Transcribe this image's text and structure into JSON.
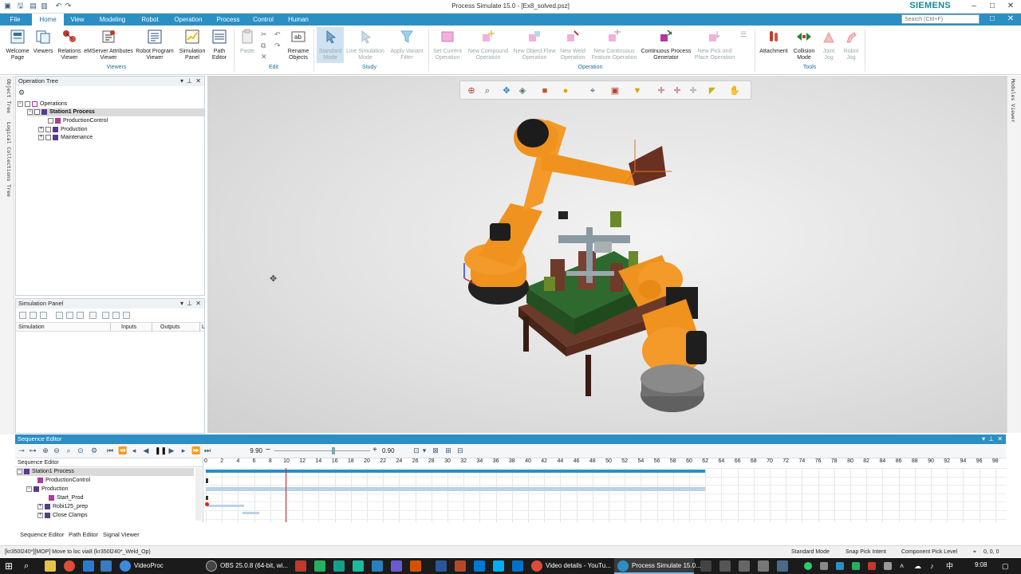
{
  "window": {
    "title": "Process Simulate 15.0 - [Ex8_solved.psz]",
    "brand": "SIEMENS",
    "search_placeholder": "Search (Ctrl+F)",
    "controls": [
      "–",
      "□",
      "✕"
    ],
    "sub_controls": [
      "–",
      "□",
      "✕"
    ]
  },
  "ribbon_tabs": [
    "File",
    "Home",
    "View",
    "Modeling",
    "Robot",
    "Operation",
    "Process",
    "Control",
    "Human"
  ],
  "active_tab": "Home",
  "ribbon": {
    "viewers": {
      "group": "Viewers",
      "buttons": [
        "Welcome Page",
        "Viewers",
        "Relations Viewer",
        "eMServer Attributes Viewer",
        "Robot Program Viewer",
        "Simulation Panel",
        "Path Editor"
      ]
    },
    "edit": {
      "group": "Edit",
      "buttons": [
        "Paste",
        "Rename Objects"
      ]
    },
    "study": {
      "group": "Study",
      "buttons": [
        "Standard Mode",
        "Line Simulation Mode",
        "Apply Variant Filter"
      ]
    },
    "operation": {
      "group": "Operation",
      "buttons": [
        "Set Current Operation",
        "New Compound Operation",
        "New Object Flow Operation",
        "New Weld Operation",
        "New Continuous Feature Operation",
        "Continuous Process Generator",
        "New Pick and Place Operation"
      ]
    },
    "tools": {
      "group": "Tools",
      "buttons": [
        "Attachment",
        "Collision Mode",
        "Joint Jog",
        "Robot Jog"
      ]
    }
  },
  "left_vertical_tabs": [
    "Object Tree",
    "Logical Collections Tree"
  ],
  "operation_tree": {
    "title": "Operation Tree",
    "items": [
      "Operations",
      "Station1 Process",
      "ProductionControl",
      "Production",
      "Maintenance"
    ]
  },
  "simulation_panel": {
    "title": "Simulation Panel",
    "columns": [
      "Simulation",
      "Inputs",
      "Outputs",
      "L"
    ]
  },
  "right_vertical_tab": "Modules Viewer",
  "sequence_editor": {
    "title": "Sequence Editor",
    "time_value": "9.90",
    "speed_value": "0.90",
    "tree_header": "Sequence Editor",
    "rows": [
      "Station1 Process",
      "ProductionControl",
      "Production",
      "Start_Prod",
      "Robi125_prep",
      "Close Clamps"
    ],
    "ticks": [
      "0",
      "2",
      "4",
      "6",
      "8",
      "10",
      "12",
      "14",
      "16",
      "18",
      "20",
      "22",
      "24",
      "26",
      "28",
      "30",
      "32",
      "34",
      "36",
      "38",
      "40",
      "42",
      "44",
      "46",
      "48",
      "50",
      "52",
      "54",
      "56",
      "58",
      "60",
      "62",
      "64",
      "66",
      "68",
      "70",
      "72",
      "74",
      "76",
      "78",
      "80",
      "82",
      "84",
      "86",
      "88",
      "90",
      "92",
      "94",
      "96",
      "98"
    ],
    "current_time": 9.9,
    "process_end": 62,
    "tabs": [
      "Sequence Editor",
      "Path Editor",
      "Signal Viewer"
    ]
  },
  "status_bar": {
    "left": "[kr350l240*][MOP] Move to loc via8 (kr350l240*_Weld_Op)",
    "mode": "Standard Mode",
    "pick_intent": "Snap Pick Intent",
    "pick_level": "Component Pick Level",
    "coords": "0, 0, 0"
  },
  "taskbar": {
    "apps": [
      "VideoProc",
      "OBS 25.0.8 (64-bit, wi...",
      "Video details - YouTu...",
      "Process Simulate 15.0..."
    ],
    "time": "9:08",
    "colors": {
      "accent": "#2b8fc4",
      "robot_orange": "#f0921e"
    }
  }
}
